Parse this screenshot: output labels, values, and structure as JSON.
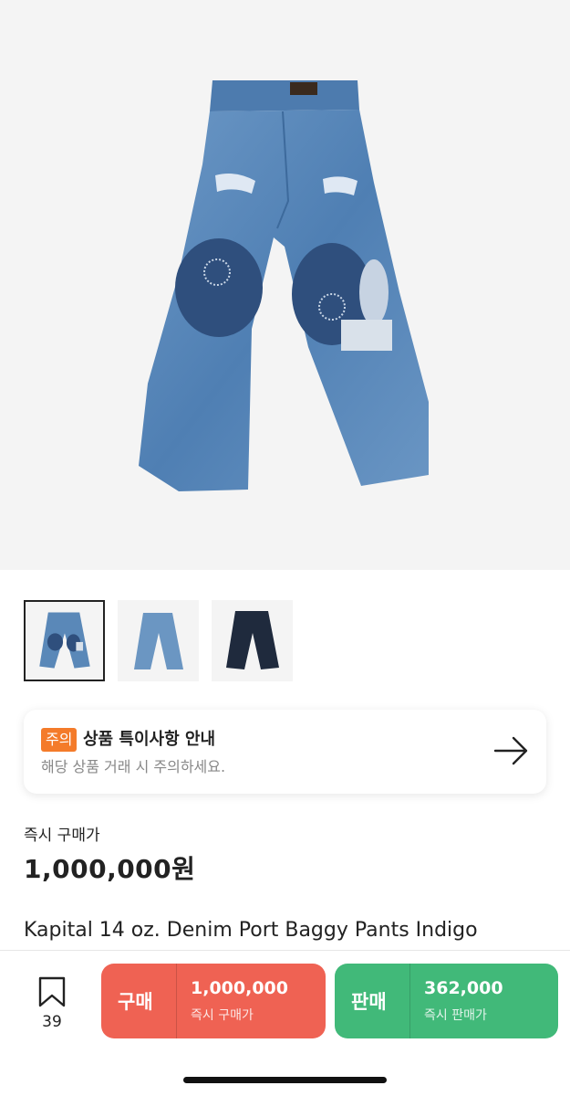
{
  "notice": {
    "badge": "주의",
    "title": "상품 특이사항 안내",
    "subtitle": "해당 상품 거래 시 주의하세요."
  },
  "price": {
    "label": "즉시 구매가",
    "value": "1,000,000원"
  },
  "product": {
    "name": "Kapital 14 oz. Denim Port Baggy Pants Indigo"
  },
  "bookmark": {
    "count": "39"
  },
  "buy": {
    "label": "구매",
    "price": "1,000,000",
    "sub": "즉시 구매가"
  },
  "sell": {
    "label": "판매",
    "price": "362,000",
    "sub": "즉시 판매가"
  },
  "thumbnails": [
    "patched-light-denim",
    "plain-light-denim",
    "dark-navy-denim"
  ],
  "colors": {
    "buy": "#ef6253",
    "sell": "#41b979",
    "badge": "#f47b2a",
    "denim": "#5a88b8"
  }
}
